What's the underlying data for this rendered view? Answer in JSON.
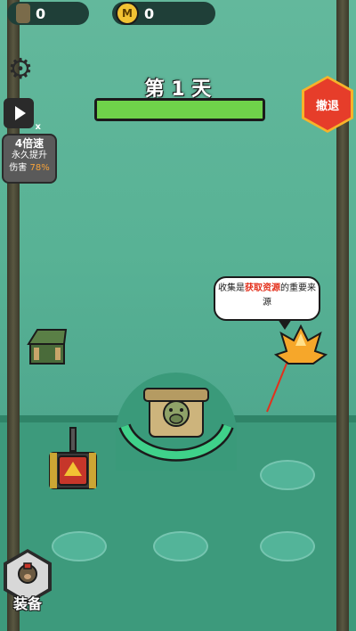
{
  "resources": {
    "ammo_count": "0",
    "coin_count": "0",
    "coin_icon_text": "M"
  },
  "day": {
    "title": "第 1 天",
    "progress": 1.0
  },
  "sidebar": {
    "speed_title": "4倍速",
    "speed_line2": "永久提升",
    "speed_line3_prefix": "伤害",
    "speed_line3_value": "78%",
    "video_multiplier": "x"
  },
  "withdraw_label": "撤退",
  "hint": {
    "prefix": "收集是",
    "highlight": "获取资源",
    "suffix": "的重要来源"
  },
  "equip_label": "装备",
  "colors": {
    "accent_green": "#6fd24a",
    "withdraw_red": "#e63d2a",
    "highlight_red": "#e3301c"
  }
}
